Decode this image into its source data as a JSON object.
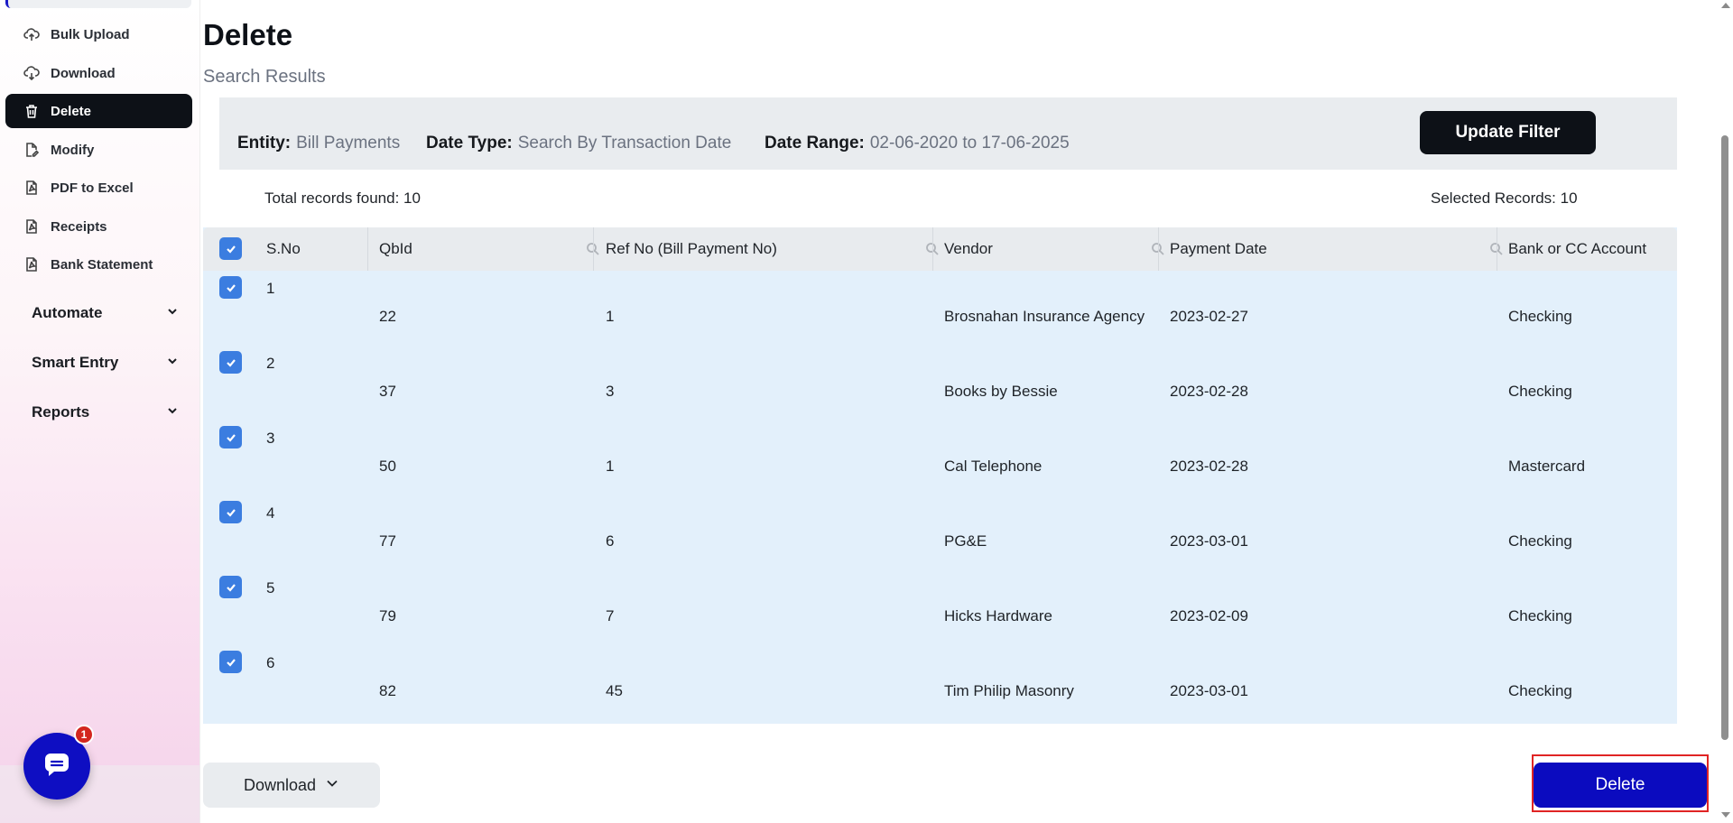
{
  "sidebar": {
    "items": [
      {
        "label": "Bulk Upload",
        "icon": "cloud-upload-icon"
      },
      {
        "label": "Download",
        "icon": "cloud-download-icon"
      },
      {
        "label": "Delete",
        "icon": "trash-icon",
        "active": true
      },
      {
        "label": "Modify",
        "icon": "edit-file-icon"
      },
      {
        "label": "PDF to Excel",
        "icon": "pdf-icon"
      },
      {
        "label": "Receipts",
        "icon": "pdf-icon"
      },
      {
        "label": "Bank Statement",
        "icon": "pdf-icon"
      }
    ],
    "groups": [
      {
        "label": "Automate",
        "icon": "chevron-down-icon"
      },
      {
        "label": "Smart Entry",
        "icon": "chevron-down-icon"
      },
      {
        "label": "Reports",
        "icon": "chevron-down-icon"
      }
    ],
    "chat_badge": "1"
  },
  "main": {
    "title": "Delete",
    "subtitle": "Search Results",
    "filter": {
      "entity_label": "Entity:",
      "entity_value": "Bill Payments",
      "date_type_label": "Date Type:",
      "date_type_value": "Search By Transaction Date",
      "date_range_label": "Date Range:",
      "date_range_value": "02-06-2020 to 17-06-2025",
      "update_button": "Update Filter"
    },
    "total_records": "Total records found: 10",
    "selected_records": "Selected Records: 10",
    "table": {
      "columns": [
        "S.No",
        "QbId",
        "Ref No (Bill Payment No)",
        "Vendor",
        "Payment Date",
        "Bank or CC Account"
      ],
      "rows": [
        {
          "sno": "1",
          "qbid": "22",
          "ref": "1",
          "vendor": "Brosnahan Insurance Agency",
          "date": "2023-02-27",
          "account": "Checking"
        },
        {
          "sno": "2",
          "qbid": "37",
          "ref": "3",
          "vendor": "Books by Bessie",
          "date": "2023-02-28",
          "account": "Checking"
        },
        {
          "sno": "3",
          "qbid": "50",
          "ref": "1",
          "vendor": "Cal Telephone",
          "date": "2023-02-28",
          "account": "Mastercard"
        },
        {
          "sno": "4",
          "qbid": "77",
          "ref": "6",
          "vendor": "PG&E",
          "date": "2023-03-01",
          "account": "Checking"
        },
        {
          "sno": "5",
          "qbid": "79",
          "ref": "7",
          "vendor": "Hicks Hardware",
          "date": "2023-02-09",
          "account": "Checking"
        },
        {
          "sno": "6",
          "qbid": "82",
          "ref": "45",
          "vendor": "Tim Philip Masonry",
          "date": "2023-03-01",
          "account": "Checking"
        }
      ]
    },
    "download_button": "Download",
    "delete_button": "Delete"
  },
  "colors": {
    "accent": "#0b0bbf",
    "active_nav": "#0d1117",
    "checkbox": "#3b7de0",
    "row_bg": "#e3f0fb",
    "highlight_outline": "#e02424"
  }
}
